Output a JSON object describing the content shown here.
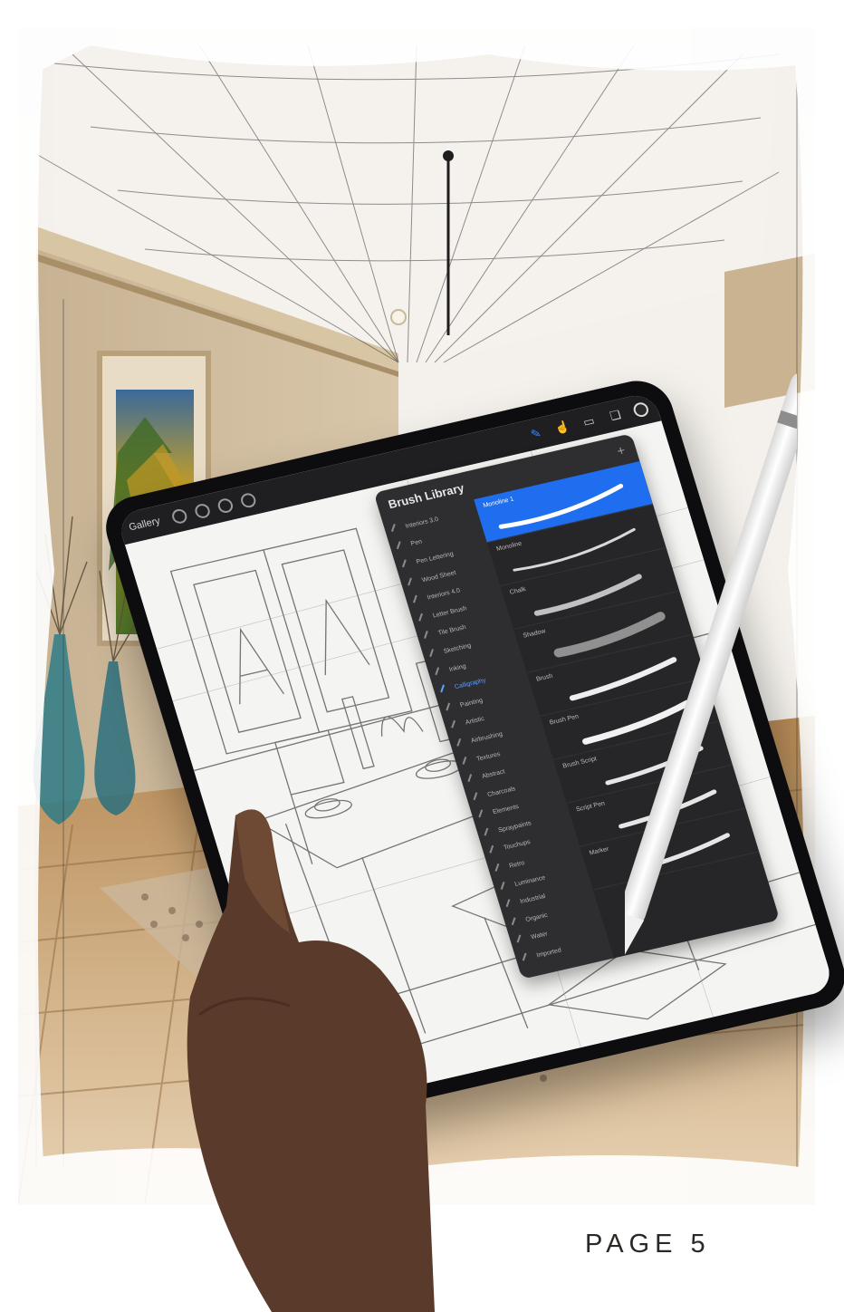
{
  "page": {
    "label": "PAGE 5"
  },
  "procreate": {
    "topbar": {
      "gallery_label": "Gallery",
      "left_tools": [
        "modify-icon",
        "selection-icon",
        "transform-icon",
        "adjust-icon"
      ],
      "right_tools": [
        "brush-icon",
        "smudge-icon",
        "eraser-icon",
        "layers-icon"
      ],
      "active_tool": "brush-icon"
    },
    "brush_library": {
      "title": "Brush Library",
      "categories": [
        "Interiors 3.0",
        "Pen",
        "Pen Lettering",
        "Wood Sheet",
        "Interiors 4.0",
        "Letter Brush",
        "Tile Brush",
        "Sketching",
        "Inking",
        "Calligraphy",
        "Painting",
        "Artistic",
        "Airbrushing",
        "Textures",
        "Abstract",
        "Charcoals",
        "Elements",
        "Spraypaints",
        "Touchups",
        "Retro",
        "Luminance",
        "Industrial",
        "Organic",
        "Water",
        "Imported"
      ],
      "active_category": "Calligraphy",
      "brushes": [
        "Monoline 1",
        "Monoline",
        "Chalk",
        "Shadow",
        "Brush",
        "Brush Pen",
        "Brush Script",
        "Script Pen",
        "Marker"
      ],
      "selected_brush": "Monoline 1",
      "accent_color": "#1f6ef0"
    }
  }
}
